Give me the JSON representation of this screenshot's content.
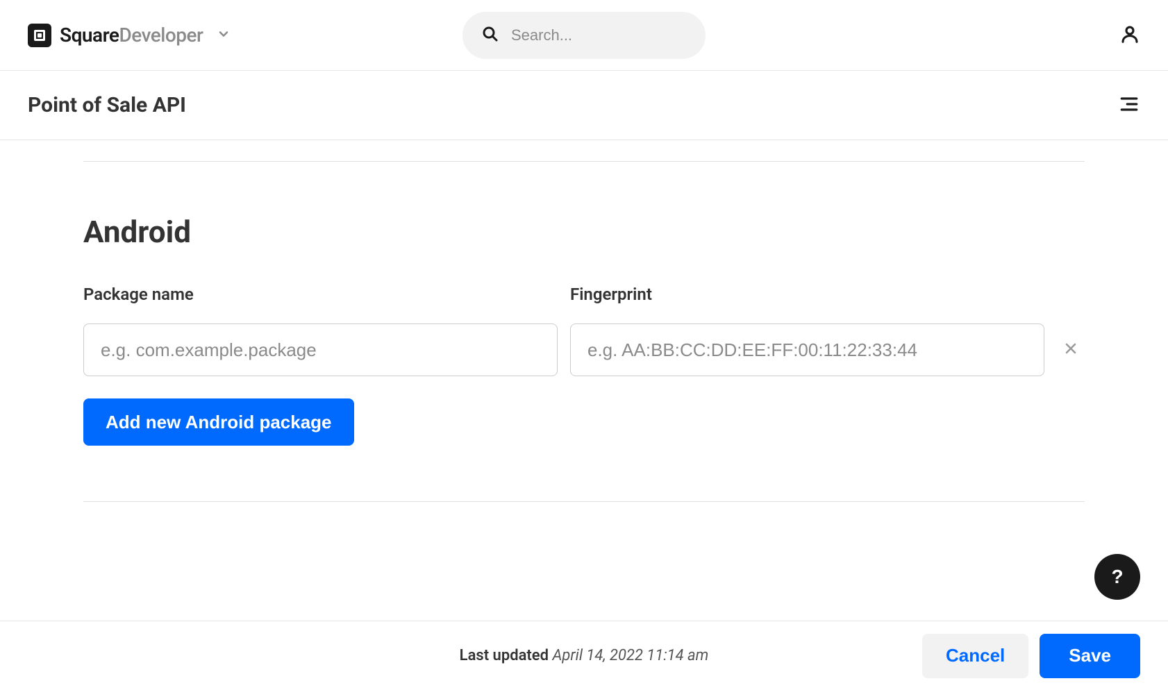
{
  "header": {
    "logo_primary": "Square",
    "logo_secondary": "Developer",
    "search_placeholder": "Search..."
  },
  "subheader": {
    "title": "Point of Sale API"
  },
  "android_section": {
    "title": "Android",
    "package_label": "Package name",
    "package_placeholder": "e.g. com.example.package",
    "fingerprint_label": "Fingerprint",
    "fingerprint_placeholder": "e.g. AA:BB:CC:DD:EE:FF:00:11:22:33:44",
    "add_button_label": "Add new Android package"
  },
  "footer": {
    "updated_label": "Last updated ",
    "updated_date": "April 14, 2022 11:14 am",
    "cancel_label": "Cancel",
    "save_label": "Save"
  },
  "help_button": "?"
}
